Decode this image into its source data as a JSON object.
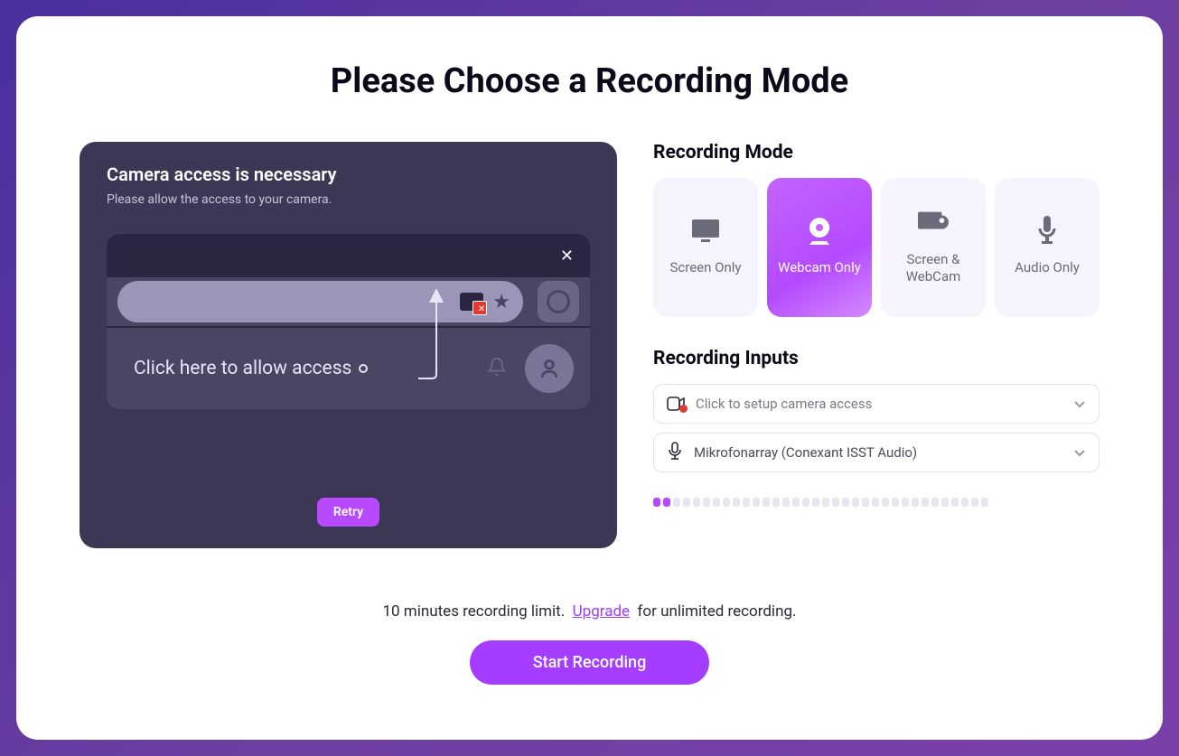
{
  "title": "Please Choose a Recording Mode",
  "left_panel": {
    "heading": "Camera access is necessary",
    "sub": "Please allow the access to your camera.",
    "click_text": "Click here to allow access",
    "retry": "Retry"
  },
  "recording_mode": {
    "heading": "Recording Mode",
    "options": [
      {
        "label": "Screen Only",
        "active": false
      },
      {
        "label": "Webcam Only",
        "active": true
      },
      {
        "label": "Screen & WebCam",
        "active": false
      },
      {
        "label": "Audio Only",
        "active": false
      }
    ]
  },
  "recording_inputs": {
    "heading": "Recording Inputs",
    "camera_text": "Click to setup camera access",
    "mic_text": "Mikrofonarray (Conexant ISST Audio)"
  },
  "footer": {
    "pre": "10 minutes recording limit.",
    "link": "Upgrade",
    "post": "for unlimited recording.",
    "start": "Start Recording"
  },
  "level_on_count": 2,
  "level_total": 34
}
